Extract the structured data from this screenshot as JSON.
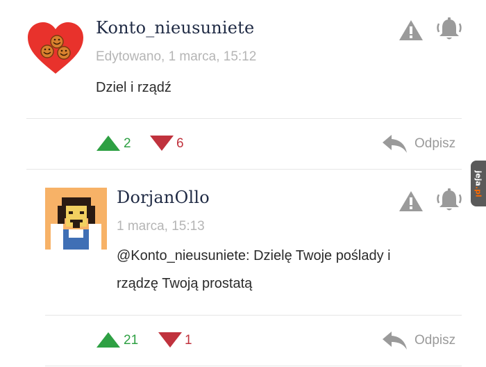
{
  "comments": [
    {
      "username": "Konto_nieusuniete",
      "meta": "Edytowano, 1 marca, 15:12",
      "text": "Dziel i rządź",
      "upvotes": "2",
      "downvotes": "6",
      "reply_label": "Odpisz",
      "avatar_icon": "heart-emoji-avatar"
    },
    {
      "username": "DorjanOllo",
      "meta": "1 marca, 15:13",
      "mention": "@Konto_nieusuniete",
      "text_line1": ": Dzielę Twoje poślady i",
      "text_line2": "rządzę Twoją prostatą",
      "upvotes": "21",
      "downvotes": "1",
      "reply_label": "Odpisz",
      "avatar_icon": "pixel-portrait-avatar"
    }
  ],
  "watermark": {
    "prefix": "jeja",
    "suffix": ".pl"
  },
  "colors": {
    "up": "#2ea043",
    "down": "#c0323d",
    "icon_gray": "#9a9a9a"
  }
}
